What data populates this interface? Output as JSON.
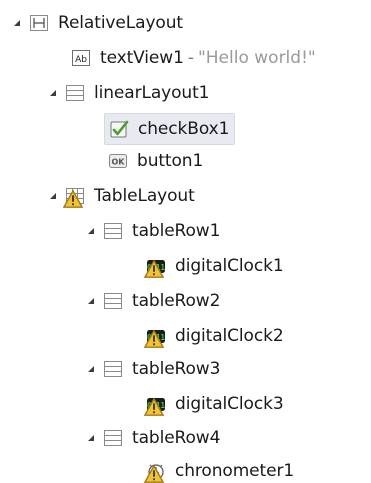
{
  "tree": {
    "relative_layout": {
      "label": "RelativeLayout",
      "icon": "relative-layout-icon"
    },
    "text_view": {
      "label": "textView1",
      "separator": "-",
      "value": "\"Hello world!\"",
      "icon": "textview-ab-icon"
    },
    "linear_layout": {
      "label": "linearLayout1",
      "icon": "linear-layout-icon"
    },
    "checkbox": {
      "label": "checkBox1",
      "icon": "checkbox-icon",
      "selected": true
    },
    "button": {
      "label": "button1",
      "icon": "button-ok-icon"
    },
    "table_layout": {
      "label": "TableLayout",
      "icon": "table-layout-icon",
      "warning": true
    },
    "table_row_1": {
      "label": "tableRow1",
      "icon": "table-row-icon"
    },
    "clock_1": {
      "label": "digitalClock1",
      "icon": "digital-clock-icon",
      "warning": true
    },
    "table_row_2": {
      "label": "tableRow2",
      "icon": "table-row-icon"
    },
    "clock_2": {
      "label": "digitalClock2",
      "icon": "digital-clock-icon",
      "warning": true
    },
    "table_row_3": {
      "label": "tableRow3",
      "icon": "table-row-icon"
    },
    "clock_3": {
      "label": "digitalClock3",
      "icon": "digital-clock-icon",
      "warning": true
    },
    "table_row_4": {
      "label": "tableRow4",
      "icon": "table-row-icon"
    },
    "chronometer": {
      "label": "chronometer1",
      "icon": "chronometer-icon",
      "warning": true
    }
  },
  "colors": {
    "expand_arrow": "#3c3c3c",
    "value_text": "#9a9a9a",
    "selection": "#e7eaf0",
    "warning": "#f2c230",
    "clock_green": "#39d039"
  }
}
